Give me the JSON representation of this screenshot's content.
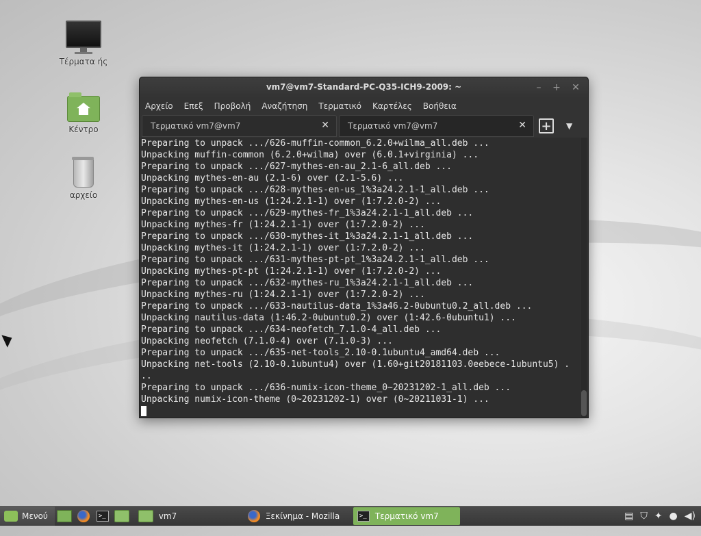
{
  "desktop": {
    "icons": [
      {
        "label": "Τέρματα ής"
      },
      {
        "label": "Κέντρο"
      },
      {
        "label": "αρχείο"
      }
    ]
  },
  "window": {
    "title": "vm7@vm7-Standard-PC-Q35-ICH9-2009: ~",
    "menus": [
      "Αρχείο",
      "Επεξ",
      "Προβολή",
      "Αναζήτηση",
      "Τερματικό",
      "Καρτέλες",
      "Βοήθεια"
    ],
    "tabs": [
      {
        "label": "Τερματικό vm7@vm7"
      },
      {
        "label": "Τερματικό vm7@vm7"
      }
    ],
    "terminal_lines": [
      "Preparing to unpack .../626-muffin-common_6.2.0+wilma_all.deb ...",
      "Unpacking muffin-common (6.2.0+wilma) over (6.0.1+virginia) ...",
      "Preparing to unpack .../627-mythes-en-au_2.1-6_all.deb ...",
      "Unpacking mythes-en-au (2.1-6) over (2.1-5.6) ...",
      "Preparing to unpack .../628-mythes-en-us_1%3a24.2.1-1_all.deb ...",
      "Unpacking mythes-en-us (1:24.2.1-1) over (1:7.2.0-2) ...",
      "Preparing to unpack .../629-mythes-fr_1%3a24.2.1-1_all.deb ...",
      "Unpacking mythes-fr (1:24.2.1-1) over (1:7.2.0-2) ...",
      "Preparing to unpack .../630-mythes-it_1%3a24.2.1-1_all.deb ...",
      "Unpacking mythes-it (1:24.2.1-1) over (1:7.2.0-2) ...",
      "Preparing to unpack .../631-mythes-pt-pt_1%3a24.2.1-1_all.deb ...",
      "Unpacking mythes-pt-pt (1:24.2.1-1) over (1:7.2.0-2) ...",
      "Preparing to unpack .../632-mythes-ru_1%3a24.2.1-1_all.deb ...",
      "Unpacking mythes-ru (1:24.2.1-1) over (1:7.2.0-2) ...",
      "Preparing to unpack .../633-nautilus-data_1%3a46.2-0ubuntu0.2_all.deb ...",
      "Unpacking nautilus-data (1:46.2-0ubuntu0.2) over (1:42.6-0ubuntu1) ...",
      "Preparing to unpack .../634-neofetch_7.1.0-4_all.deb ...",
      "Unpacking neofetch (7.1.0-4) over (7.1.0-3) ...",
      "Preparing to unpack .../635-net-tools_2.10-0.1ubuntu4_amd64.deb ...",
      "Unpacking net-tools (2.10-0.1ubuntu4) over (1.60+git20181103.0eebece-1ubuntu5) .",
      "..",
      "Preparing to unpack .../636-numix-icon-theme_0~20231202-1_all.deb ...",
      "Unpacking numix-icon-theme (0~20231202-1) over (0~20211031-1) ..."
    ]
  },
  "panel": {
    "menu_label": "Μενού",
    "tasks": [
      {
        "label": "vm7"
      },
      {
        "label": "Ξεκίνημα - Mozilla"
      },
      {
        "label": "Τερματικό vm7"
      }
    ],
    "tray_icons": [
      "clipboard-icon",
      "shield-icon",
      "notification-icon",
      "user-icon",
      "volume-icon"
    ]
  }
}
